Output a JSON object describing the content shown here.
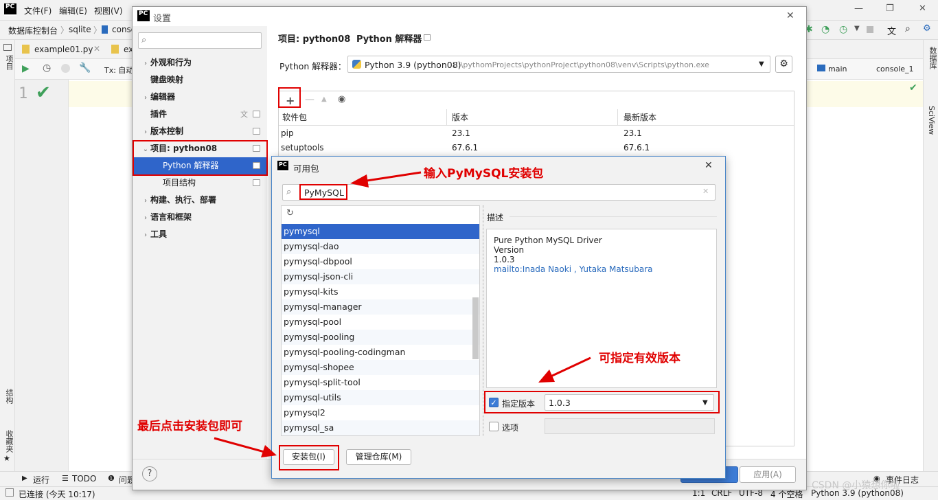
{
  "ide": {
    "logo": "PC",
    "menu": [
      "文件(F)",
      "编辑(E)",
      "视图(V)"
    ],
    "breadcrumb": [
      "数据库控制台",
      "sqlite",
      "conso"
    ],
    "tabs": [
      "example01.py",
      "ex"
    ],
    "toolbar": {
      "tx": "Tx: 自动",
      "branch": "main",
      "console": "console_1"
    },
    "line_number": "1",
    "left_strip": [
      "项目",
      "结构",
      "收藏夹"
    ],
    "right_strip": [
      "数据库",
      "SciView"
    ],
    "bottom_tabs": [
      "运行",
      "TODO",
      "问题",
      "事件日志"
    ],
    "status": {
      "left": "已连接 (今天 10:17)",
      "pos": "1:1",
      "eol": "CRLF",
      "enc": "UTF-8",
      "indent": "4 个空格",
      "interpreter": "Python 3.9 (python08)"
    }
  },
  "settings": {
    "title": "设置",
    "search_placeholder": "",
    "nav": [
      {
        "label": "外观和行为",
        "bold": true,
        "chev": true
      },
      {
        "label": "键盘映射",
        "bold": true,
        "chev": false
      },
      {
        "label": "编辑器",
        "bold": true,
        "chev": true
      },
      {
        "label": "插件",
        "bold": true,
        "chev": false
      },
      {
        "label": "版本控制",
        "bold": true,
        "chev": true
      },
      {
        "label": "项目: python08",
        "bold": true,
        "chev": true
      },
      {
        "label": "Python 解释器",
        "bold": false,
        "chev": false
      },
      {
        "label": "项目结构",
        "bold": false,
        "chev": false
      },
      {
        "label": "构建、执行、部署",
        "bold": true,
        "chev": true
      },
      {
        "label": "语言和框架",
        "bold": true,
        "chev": true
      },
      {
        "label": "工具",
        "bold": true,
        "chev": true
      }
    ],
    "breadcrumb": [
      "项目: python08",
      "Python 解释器"
    ],
    "interpreter_label": "Python 解释器：",
    "interpreter_value": "Python 3.9 (python08)",
    "interpreter_path": "E:\\pythomProjects\\pythonProject\\python08\\venv\\Scripts\\python.exe",
    "columns": [
      "软件包",
      "版本",
      "最新版本"
    ],
    "packages": [
      {
        "name": "pip",
        "version": "23.1",
        "latest": "23.1"
      },
      {
        "name": "setuptools",
        "version": "67.6.1",
        "latest": "67.6.1"
      }
    ],
    "apply": "应用(A)"
  },
  "available": {
    "title": "可用包",
    "search_value": "PyMySQL",
    "list": [
      "pymysql",
      "pymysql-dao",
      "pymysql-dbpool",
      "pymysql-json-cli",
      "pymysql-kits",
      "pymysql-manager",
      "pymysql-pool",
      "pymysql-pooling",
      "pymysql-pooling-codingman",
      "pymysql-shopee",
      "pymysql-split-tool",
      "pymysql-utils",
      "pymysql2",
      "pymysql_sa"
    ],
    "desc_label": "描述",
    "desc": [
      "Pure Python MySQL Driver",
      "Version",
      "1.0.3"
    ],
    "desc_link": "mailto:Inada Naoki , Yutaka Matsubara",
    "specify_version_label": "指定版本",
    "specify_version_value": "1.0.3",
    "options_label": "选项",
    "install_button": "安装包(I)",
    "manage_button": "管理仓库(M)"
  },
  "annotations": {
    "search": "输入PyMySQL安装包",
    "version": "可指定有效版本",
    "install": "最后点击安装包即可"
  },
  "watermark": "CSDN @小猿想你啦",
  "colors": {
    "selection": "#2f65ca",
    "annotation": "#e00000",
    "link": "#2a6bbd",
    "check": "#3fa05a"
  }
}
